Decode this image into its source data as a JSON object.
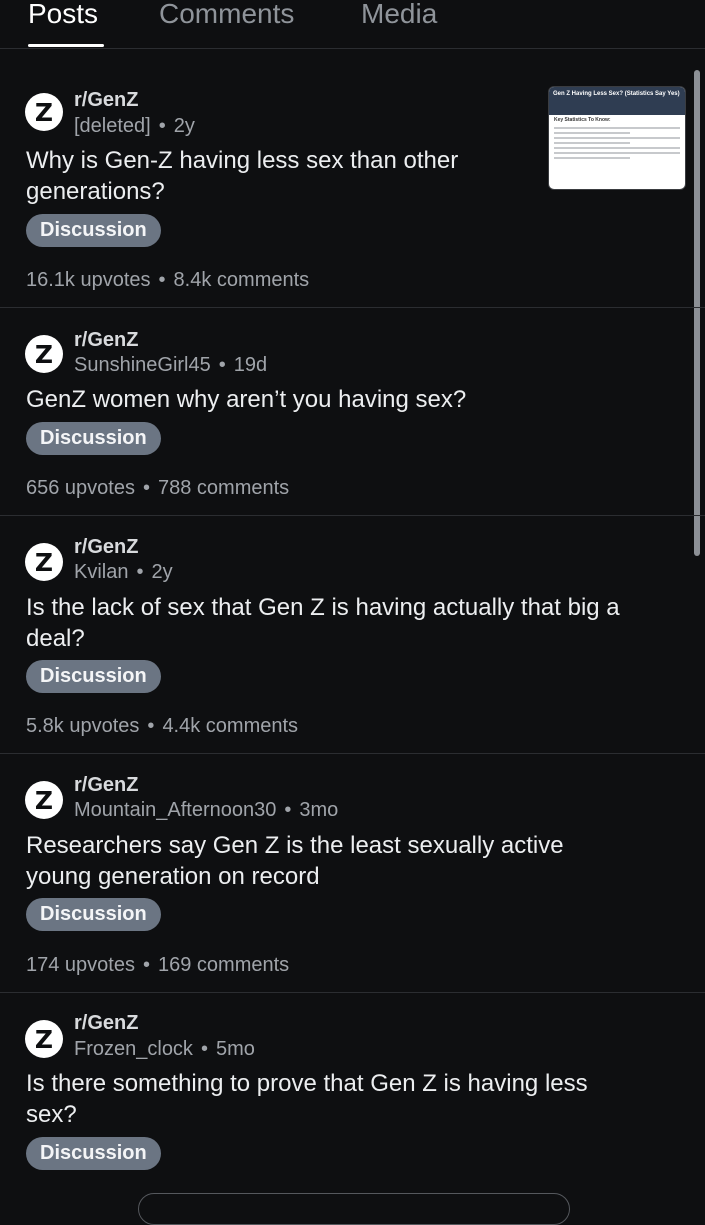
{
  "tabs": [
    {
      "label": "Posts",
      "active": true
    },
    {
      "label": "Comments",
      "active": false
    },
    {
      "label": "Media",
      "active": false
    }
  ],
  "avatar_letter": "Z",
  "posts": [
    {
      "subreddit": "r/GenZ",
      "author": "[deleted]",
      "age": "2y",
      "title_lines": [
        "Why is Gen-Z having less sex than other",
        "generations?"
      ],
      "flair": "Discussion",
      "upvotes": "16.1k upvotes",
      "comments": "8.4k comments",
      "thumbnail": {
        "heading": "Gen Z Having Less Sex? (Statistics Say Yes)",
        "subheading": "Key Statistics To Know:"
      }
    },
    {
      "subreddit": "r/GenZ",
      "author": "SunshineGirl45",
      "age": "19d",
      "title_lines": [
        "GenZ women why aren’t you having sex?"
      ],
      "flair": "Discussion",
      "upvotes": "656 upvotes",
      "comments": "788 comments"
    },
    {
      "subreddit": "r/GenZ",
      "author": "Kvilan",
      "age": "2y",
      "title_lines": [
        "Is the lack of sex that Gen Z is having actually that big a",
        "deal?"
      ],
      "flair": "Discussion",
      "upvotes": "5.8k upvotes",
      "comments": "4.4k comments"
    },
    {
      "subreddit": "r/GenZ",
      "author": "Mountain_Afternoon30",
      "age": "3mo",
      "title_lines": [
        "Researchers say Gen Z is the least sexually active",
        "young generation on record"
      ],
      "flair": "Discussion",
      "upvotes": "174 upvotes",
      "comments": "169 comments"
    },
    {
      "subreddit": "r/GenZ",
      "author": "Frozen_clock",
      "age": "5mo",
      "title_lines": [
        "Is there something to prove that Gen Z is having less",
        "sex?"
      ],
      "flair": "Discussion"
    }
  ],
  "separator": "•"
}
